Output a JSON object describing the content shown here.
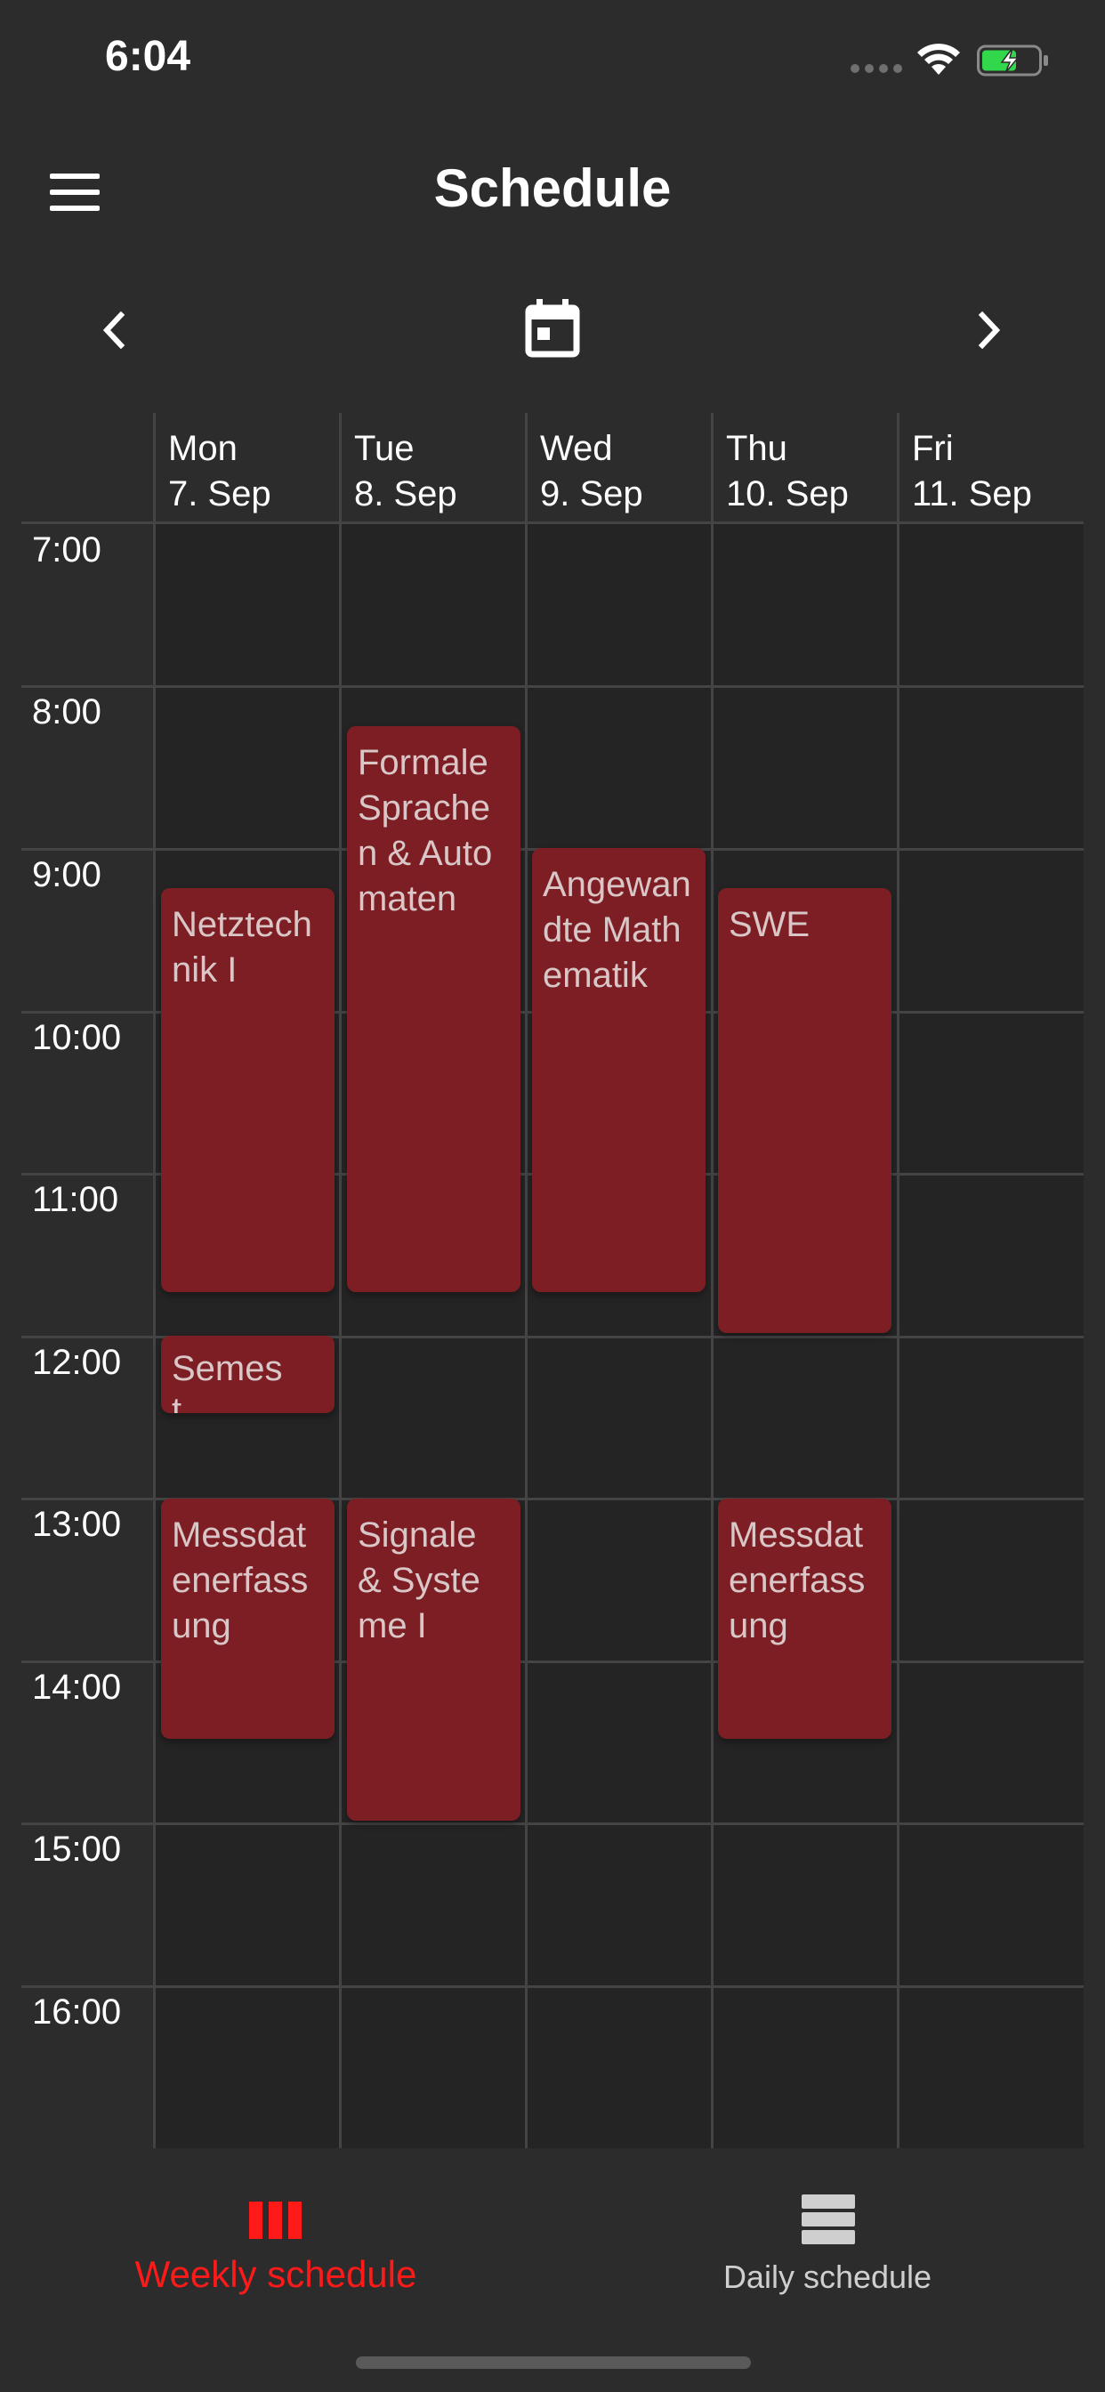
{
  "status_bar": {
    "time": "6:04"
  },
  "header": {
    "title": "Schedule"
  },
  "days": [
    {
      "name": "Mon",
      "date": "7. Sep"
    },
    {
      "name": "Tue",
      "date": "8. Sep"
    },
    {
      "name": "Wed",
      "date": "9. Sep"
    },
    {
      "name": "Thu",
      "date": "10. Sep"
    },
    {
      "name": "Fri",
      "date": "11. Sep"
    }
  ],
  "time_slots": [
    "7:00",
    "8:00",
    "9:00",
    "10:00",
    "11:00",
    "12:00",
    "13:00",
    "14:00",
    "15:00",
    "16:00"
  ],
  "events": [
    {
      "title": "Netztechnik I",
      "day": "Mon",
      "start": "9:00",
      "end": "11:45"
    },
    {
      "title": "Semest…",
      "day": "Mon",
      "start": "12:00",
      "end": "12:30"
    },
    {
      "title": "Messdatenerfassung",
      "day": "Mon",
      "start": "13:00",
      "end": "14:30"
    },
    {
      "title": "Formale Sprachen & Automaten",
      "day": "Tue",
      "start": "8:15",
      "end": "11:45"
    },
    {
      "title": "Signale & Systeme I",
      "day": "Tue",
      "start": "13:00",
      "end": "15:00"
    },
    {
      "title": "Angewandte Mathematik",
      "day": "Wed",
      "start": "8:45",
      "end": "11:45"
    },
    {
      "title": "SWE",
      "day": "Thu",
      "start": "9:00",
      "end": "12:00"
    },
    {
      "title": "Messdatenerfassung",
      "day": "Thu",
      "start": "13:00",
      "end": "14:30"
    }
  ],
  "bottom_nav": {
    "weekly_label": "Weekly schedule",
    "daily_label": "Daily schedule",
    "active": "weekly"
  },
  "colors": {
    "background": "#2c2c2c",
    "grid_background": "#242424",
    "event": "#7d1e25",
    "accent": "#ff1a1a"
  }
}
